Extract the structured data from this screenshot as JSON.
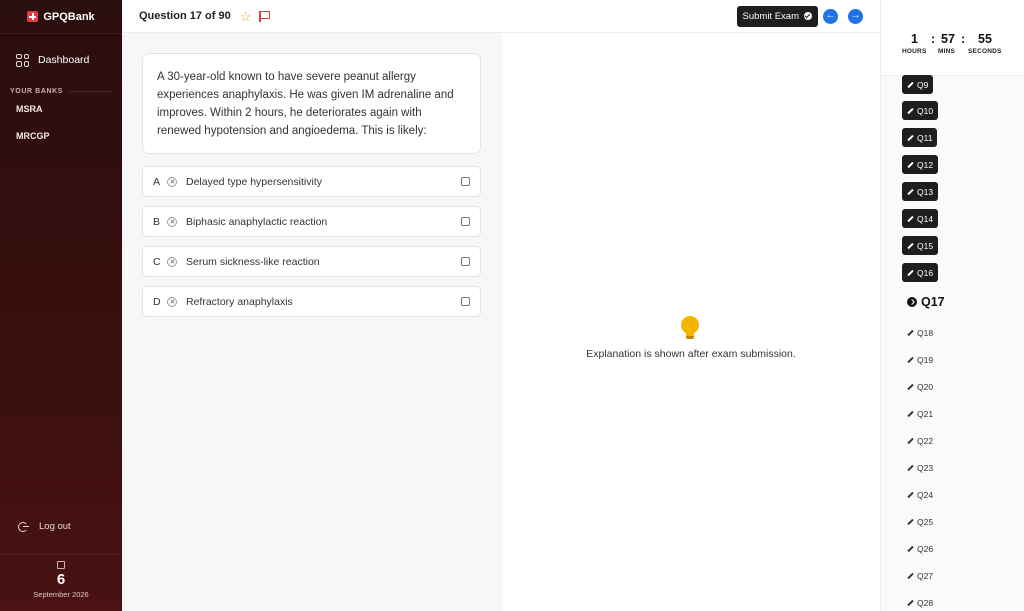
{
  "app": {
    "name": "GPQBank"
  },
  "sidebar": {
    "dashboard_label": "Dashboard",
    "banks_heading": "YOUR BANKS",
    "banks": [
      "MSRA",
      "MRCGP"
    ],
    "logout_label": "Log out",
    "date": {
      "day": "6",
      "month_year": "September 2026"
    }
  },
  "header": {
    "question_counter": "Question 17 of 90",
    "submit_label": "Submit Exam"
  },
  "question": {
    "stem": "A 30-year-old known to have severe peanut allergy experiences anaphylaxis. He was given IM adrenaline and improves. Within 2 hours, he deteriorates again with renewed hypotension and angioedema. This is likely:",
    "options": [
      {
        "letter": "A",
        "text": "Delayed type hypersensitivity"
      },
      {
        "letter": "B",
        "text": "Biphasic anaphylactic reaction"
      },
      {
        "letter": "C",
        "text": "Serum sickness-like reaction"
      },
      {
        "letter": "D",
        "text": "Refractory anaphylaxis"
      }
    ]
  },
  "explanation": {
    "message": "Explanation is shown after exam submission."
  },
  "timer": {
    "hours": "1",
    "minutes": "57",
    "seconds": "55",
    "hours_label": "HOURS",
    "minutes_label": "MINS",
    "seconds_label": "SECONDS",
    "separator": ":"
  },
  "question_nav": [
    {
      "label": "Q9",
      "state": "answered"
    },
    {
      "label": "Q10",
      "state": "answered"
    },
    {
      "label": "Q11",
      "state": "answered"
    },
    {
      "label": "Q12",
      "state": "answered"
    },
    {
      "label": "Q13",
      "state": "answered"
    },
    {
      "label": "Q14",
      "state": "answered"
    },
    {
      "label": "Q15",
      "state": "answered"
    },
    {
      "label": "Q16",
      "state": "answered"
    },
    {
      "label": "Q17",
      "state": "current"
    },
    {
      "label": "Q18",
      "state": "pending"
    },
    {
      "label": "Q19",
      "state": "pending"
    },
    {
      "label": "Q20",
      "state": "pending"
    },
    {
      "label": "Q21",
      "state": "pending"
    },
    {
      "label": "Q22",
      "state": "pending"
    },
    {
      "label": "Q23",
      "state": "pending"
    },
    {
      "label": "Q24",
      "state": "pending"
    },
    {
      "label": "Q25",
      "state": "pending"
    },
    {
      "label": "Q26",
      "state": "pending"
    },
    {
      "label": "Q27",
      "state": "pending"
    },
    {
      "label": "Q28",
      "state": "pending"
    }
  ],
  "colors": {
    "sidebar_bg": "#2a0d0d",
    "accent_blue": "#1f73e6",
    "logo_red": "#e0393e",
    "star": "#e8a317",
    "flag": "#d64545",
    "bulb": "#f4b400",
    "dark_button": "#1e1e1e"
  },
  "icons": [
    "plus-logo-icon",
    "grid-icon",
    "logout-icon",
    "calendar-icon",
    "star-icon",
    "flag-icon",
    "check-circle-icon",
    "arrow-left-icon",
    "arrow-right-icon",
    "x-circle-icon",
    "checkbox-icon",
    "bulb-icon",
    "pencil-icon",
    "current-arrow-icon"
  ]
}
